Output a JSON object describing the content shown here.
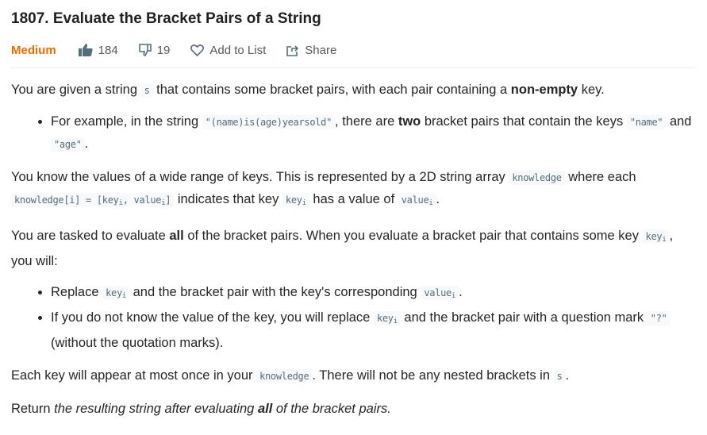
{
  "title": "1807. Evaluate the Bracket Pairs of a String",
  "difficulty": "Medium",
  "difficulty_color": "#ef6c00",
  "likes": "184",
  "dislikes": "19",
  "add_to_list": "Add to List",
  "share": "Share",
  "blocks": [
    {
      "type": "p",
      "segs": [
        {
          "t": "text",
          "v": "You are given a string "
        },
        {
          "t": "code",
          "v": "s"
        },
        {
          "t": "text",
          "v": " that contains some bracket pairs, with each pair containing a "
        },
        {
          "t": "b",
          "v": "non-empty"
        },
        {
          "t": "text",
          "v": " key."
        }
      ]
    },
    {
      "type": "ul",
      "items": [
        [
          {
            "t": "text",
            "v": "For example, in the string "
          },
          {
            "t": "code",
            "v": "\"(name)is(age)yearsold\""
          },
          {
            "t": "text",
            "v": ", there are "
          },
          {
            "t": "b",
            "v": "two"
          },
          {
            "t": "text",
            "v": " bracket pairs that contain the keys "
          },
          {
            "t": "code",
            "v": "\"name\""
          },
          {
            "t": "text",
            "v": " and "
          },
          {
            "t": "code",
            "v": "\"age\""
          },
          {
            "t": "text",
            "v": "."
          }
        ]
      ]
    },
    {
      "type": "p",
      "segs": [
        {
          "t": "text",
          "v": "You know the values of a wide range of keys. This is represented by a 2D string array "
        },
        {
          "t": "code",
          "v": "knowledge"
        },
        {
          "t": "text",
          "v": " where each "
        },
        {
          "t": "code",
          "v": "knowledge[i] = [key",
          "sub": "i",
          "after": ", value",
          "sub2": "i",
          "end": "]"
        },
        {
          "t": "text",
          "v": " indicates that key "
        },
        {
          "t": "code",
          "v": "key",
          "sub": "i"
        },
        {
          "t": "text",
          "v": " has a value of "
        },
        {
          "t": "code",
          "v": "value",
          "sub": "i"
        },
        {
          "t": "text",
          "v": "."
        }
      ]
    },
    {
      "type": "p",
      "segs": [
        {
          "t": "text",
          "v": "You are tasked to evaluate "
        },
        {
          "t": "b",
          "v": "all"
        },
        {
          "t": "text",
          "v": " of the bracket pairs. When you evaluate a bracket pair that contains some key "
        },
        {
          "t": "code",
          "v": "key",
          "sub": "i"
        },
        {
          "t": "text",
          "v": ", you will:"
        }
      ]
    },
    {
      "type": "ul",
      "items": [
        [
          {
            "t": "text",
            "v": "Replace "
          },
          {
            "t": "code",
            "v": "key",
            "sub": "i"
          },
          {
            "t": "text",
            "v": " and the bracket pair with the key's corresponding "
          },
          {
            "t": "code",
            "v": "value",
            "sub": "i"
          },
          {
            "t": "text",
            "v": "."
          }
        ],
        [
          {
            "t": "text",
            "v": "If you do not know the value of the key, you will replace "
          },
          {
            "t": "code",
            "v": "key",
            "sub": "i"
          },
          {
            "t": "text",
            "v": " and the bracket pair with a question mark "
          },
          {
            "t": "code",
            "v": "\"?\""
          },
          {
            "t": "text",
            "v": " (without the quotation marks)."
          }
        ]
      ]
    },
    {
      "type": "p",
      "segs": [
        {
          "t": "text",
          "v": "Each key will appear at most once in your "
        },
        {
          "t": "code",
          "v": "knowledge"
        },
        {
          "t": "text",
          "v": ". There will not be any nested brackets in "
        },
        {
          "t": "code",
          "v": "s"
        },
        {
          "t": "text",
          "v": "."
        }
      ]
    },
    {
      "type": "p",
      "segs": [
        {
          "t": "text",
          "v": "Return "
        },
        {
          "t": "i",
          "v": "the resulting string after evaluating "
        },
        {
          "t": "bi",
          "v": "all"
        },
        {
          "t": "i",
          "v": " of the bracket pairs."
        }
      ]
    }
  ]
}
